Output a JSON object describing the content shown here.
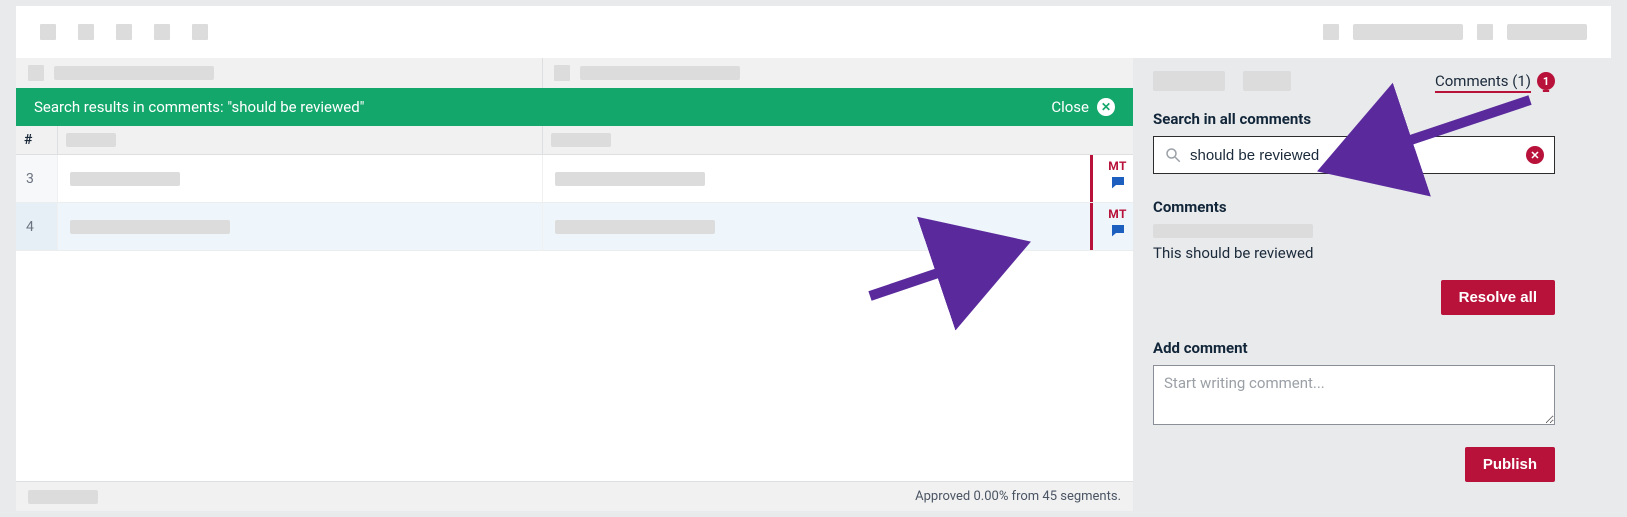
{
  "banner": {
    "text": "Search results in comments: \"should be reviewed\"",
    "close_label": "Close"
  },
  "grid": {
    "header": {
      "num": "#"
    },
    "rows": [
      {
        "num": "3",
        "mt_label": "MT"
      },
      {
        "num": "4",
        "mt_label": "MT"
      }
    ]
  },
  "footer": {
    "status": "Approved 0.00% from 45 segments."
  },
  "sidebar": {
    "comments_tab_label": "Comments (1)",
    "comments_tab_badge": "1",
    "search_title": "Search in all comments",
    "search_value": "should be reviewed",
    "comments_title": "Comments",
    "comment_text": "This should be reviewed",
    "resolve_all_label": "Resolve all",
    "add_comment_title": "Add comment",
    "add_comment_placeholder": "Start writing comment...",
    "publish_label": "Publish"
  }
}
